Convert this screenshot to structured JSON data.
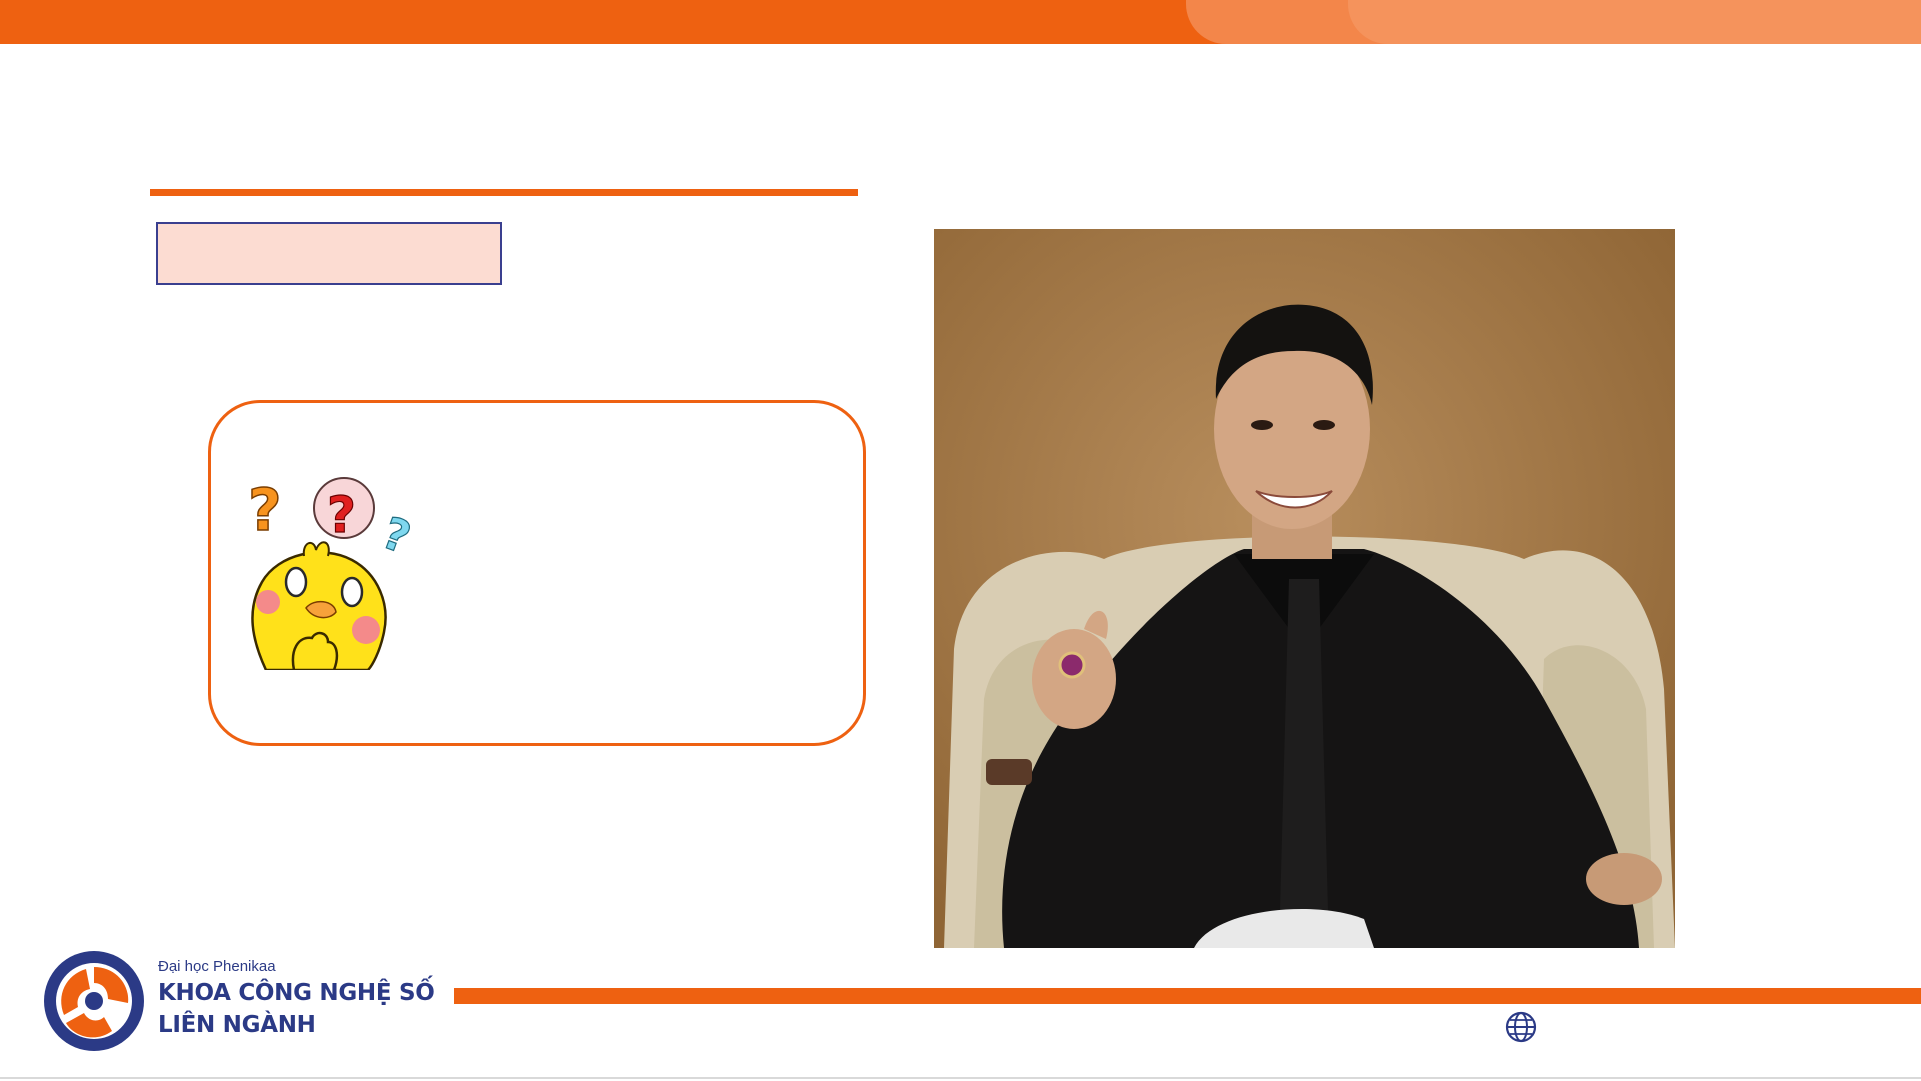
{
  "slide": {
    "title": "",
    "label": "",
    "question_text": ""
  },
  "photo": {
    "description_icon": "portrait-photo"
  },
  "footer": {
    "university": "Đại học Phenikaa",
    "faculty_line1": "KHOA CÔNG NGHỆ SỐ",
    "faculty_line2": "LIÊN NGÀNH",
    "website_icon": "globe-icon"
  },
  "colors": {
    "accent": "#ee6111",
    "brand_blue": "#2b3a86",
    "label_fill": "#fcdcd2"
  }
}
